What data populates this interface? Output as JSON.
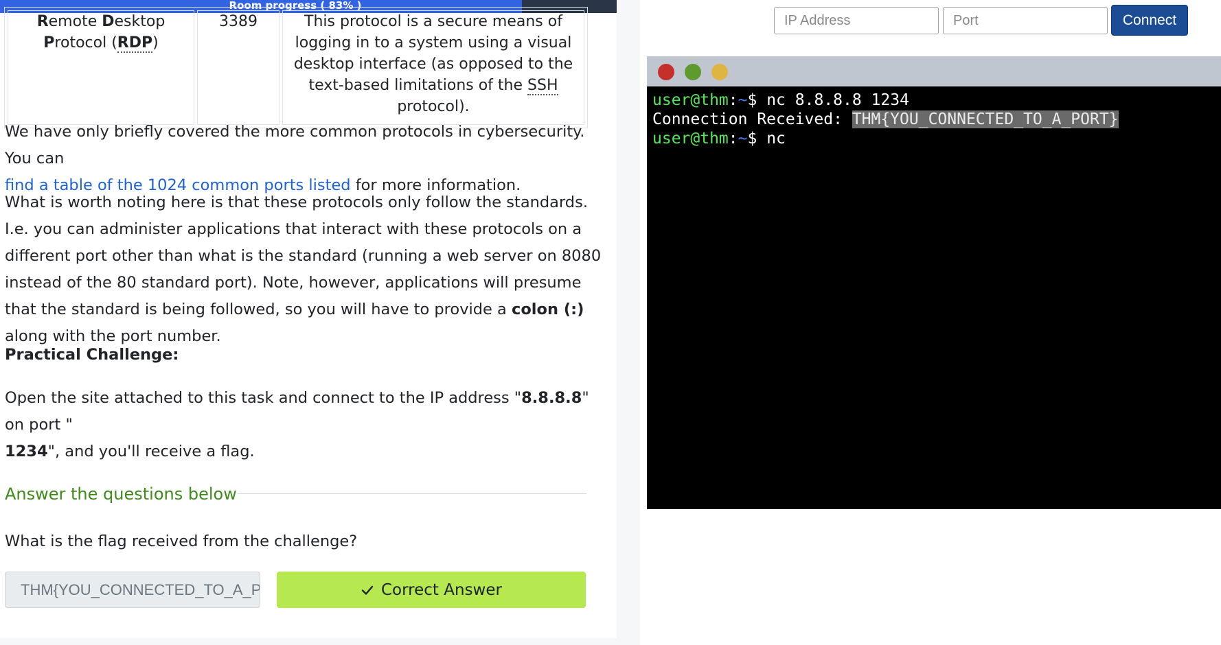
{
  "progress": {
    "label": "Room progress ( 83% )",
    "fraction": 0.83
  },
  "protocol_table": {
    "row": {
      "protocol_line1_bold1": "R",
      "protocol_line1_rest1": "emote ",
      "protocol_line1_bold2": "D",
      "protocol_line1_rest2": "esktop",
      "protocol_line2_bold": "P",
      "protocol_line2_rest": "rotocol (",
      "protocol_abbr": "RDP",
      "protocol_close": ")",
      "port": "3389",
      "description_pre": "This protocol is a secure means of logging in to a system using a visual desktop interface (as opposed to the text-based limitations of the ",
      "description_abbr": "SSH",
      "description_post": " protocol)."
    }
  },
  "content": {
    "p1_text": "We have only briefly covered the more common protocols in cybersecurity. You can",
    "p1_link": "find a table of the 1024 common ports listed",
    "p1_tail": " for more information.",
    "p2_pre": "What is worth noting here is that these protocols only follow the standards. I.e. you can administer applications that interact with these protocols on a different port other than what is the standard (running a web server on 8080 instead of the 80 standard port). Note, however, applications will presume that the standard is being followed, so you will have to provide a ",
    "p2_bold": "colon (:)",
    "p2_post": " along with the port number.",
    "challenge_heading": "Practical Challenge:",
    "p3_a": "Open the site attached to this task and connect to the IP address \"",
    "p3_ip": "8.8.8.8",
    "p3_b": "\" on port \"",
    "p3_port": "1234",
    "p3_c": "\", and you'll receive a flag."
  },
  "answers": {
    "heading": "Answer the questions below",
    "question": "What is the flag received from the challenge?",
    "answer_value": "THM{YOU_CONNECTED_TO_A_PORT}",
    "button_label": "Correct Answer",
    "button_icon": "check-icon"
  },
  "connect_form": {
    "ip_placeholder": "IP Address",
    "port_placeholder": "Port",
    "connect_label": "Connect"
  },
  "terminal": {
    "user_host": "user@thm",
    "colon": ":",
    "tilde": "~",
    "prompt": "$ ",
    "line1_cmd": "nc 8.8.8.8 1234",
    "line2_label": "Connection Received: ",
    "line2_flag": "THM{YOU_CONNECTED_TO_A_PORT}",
    "line3_cmd": "nc"
  },
  "colors": {
    "progress_fill": "#3263e0",
    "progress_track": "#2a3547",
    "link": "#1f62d4",
    "answers_heading": "#3f8a1a",
    "correct_button": "#b6e94f",
    "connect_button": "#1c4d94",
    "terminal_user": "#56e85a",
    "terminal_path": "#4a7cf0"
  }
}
